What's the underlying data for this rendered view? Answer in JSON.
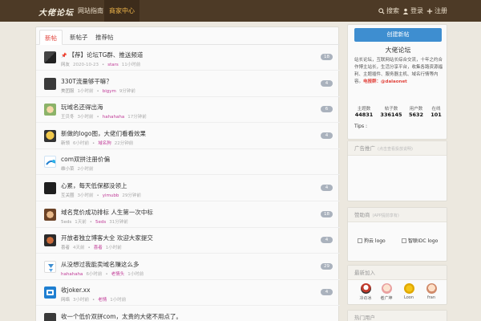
{
  "topbar": {
    "logo": "大佬论坛",
    "nav": [
      "网站指南",
      "商家中心"
    ],
    "search": "搜索",
    "login": "登录",
    "register": "注册"
  },
  "tabs": [
    "新帖",
    "新帖子",
    "推荐帖"
  ],
  "topics": [
    {
      "title": "【荐】论坛TG群、推送频道",
      "pinned": true,
      "node": "网友",
      "time": "2020-10-23",
      "sep": "•",
      "last": "stars",
      "last_time": "11小时前",
      "count": "18",
      "avatar": "tg"
    },
    {
      "title": "330T流量够干嘛？",
      "pinned": false,
      "node": "美团服",
      "time": "1小时前",
      "sep": "•",
      "last": "bigym",
      "last_time": "9分钟前",
      "count": "4",
      "avatar": "dark"
    },
    {
      "title": "玩域名还得出海",
      "pinned": false,
      "node": "王贝冬",
      "time": "3小时前",
      "sep": "•",
      "last": "hahahaha",
      "last_time": "17分钟前",
      "count": "6",
      "avatar": "flower"
    },
    {
      "title": "新做的logo图，大佬们看看效果",
      "pinned": false,
      "node": "新领",
      "time": "6小时前",
      "sep": "•",
      "last": "域名狗",
      "last_time": "22分钟前",
      "count": "4",
      "avatar": "cartoon"
    },
    {
      "title": "com双拼注册价偏",
      "pinned": false,
      "node": "维小菜",
      "time": "2小时前",
      "sep": "",
      "last": "",
      "last_time": "",
      "count": "",
      "avatar": "blue"
    },
    {
      "title": "心累，每天低保都没领上",
      "pinned": false,
      "node": "互关圈",
      "time": "3小时前",
      "sep": "•",
      "last": "yimubb",
      "last_time": "29分钟前",
      "count": "4",
      "avatar": "black"
    },
    {
      "title": "域名竞价成功排标 人生第一次中标",
      "pinned": false,
      "node": "5eds",
      "time": "1天前",
      "sep": "•",
      "last": "5eds",
      "last_time": "31分钟前",
      "count": "18",
      "avatar": "monkey"
    },
    {
      "title": "开放者独立博客大全 欢迎大家提交",
      "pinned": false,
      "node": "喜者",
      "time": "4天前",
      "sep": "•",
      "last": "喜者",
      "last_time": "1小时前",
      "count": "4",
      "avatar": "cat"
    },
    {
      "title": "从没想过我能卖域名赚这么多",
      "pinned": false,
      "node": "hahahaha",
      "time": "6小时前",
      "sep": "•",
      "last": "老情头",
      "last_time": "1小时前",
      "count": "29",
      "avatar": "ribbon"
    },
    {
      "title": "收joker.xx",
      "pinned": false,
      "node": "网络",
      "time": "3小时前",
      "sep": "•",
      "last": "老情",
      "last_time": "1小时前",
      "count": "4",
      "avatar": "bluebig"
    },
    {
      "title": "收一个低价双拼com，太贵的大佬不用点了。",
      "pinned": false,
      "node": "",
      "time": "",
      "sep": "",
      "last": "",
      "last_time": "",
      "count": "",
      "avatar": "dark"
    }
  ],
  "sidebar": {
    "new_post": "创建新帖",
    "forum_name": "大佬论坛",
    "desc_prefix": "站长论坛，互联网站长综合交流，十年之约合作博主站长，生活分享平台，收集各路资源福利、主题插件、服务器主机、域名行情等内容。",
    "desc_tel": "电报群：@dalaonet",
    "stats": [
      {
        "label": "主题数",
        "value": "44831"
      },
      {
        "label": "帖子数",
        "value": "336145"
      },
      {
        "label": "用户数",
        "value": "5632"
      },
      {
        "label": "在线",
        "value": "101"
      }
    ],
    "tips": "Tips :",
    "ad_head": "广告推广",
    "ad_sub": "(点击查看投放说明)",
    "sponsor_head": "赞助商",
    "sponsor_sub": "(APP提前享有)",
    "sponsors": [
      "狗云 logo",
      "智联IDC logo"
    ],
    "recent_head": "最新加入",
    "members": [
      "冷の冰",
      "者广坤",
      "Loon",
      "fran"
    ],
    "next_head": "热门用户"
  },
  "colors": {
    "topbar": "#4d3a26",
    "accent": "#e2463f",
    "button": "#3e8ed0",
    "link_hl": "#c03a97"
  }
}
